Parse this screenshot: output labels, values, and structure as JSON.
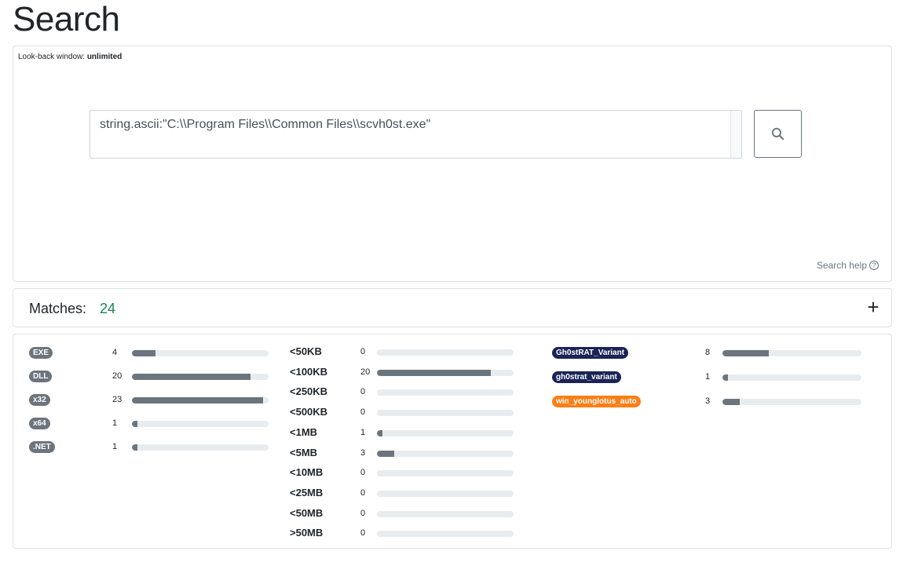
{
  "page_title": "Search",
  "search": {
    "lookback_label": "Look-back window:",
    "lookback_value": "unlimited",
    "query": "string.ascii:\"C:\\\\Program Files\\\\Common Files\\\\scvh0st.exe\"",
    "help_label": "Search help",
    "help_icon": "?"
  },
  "matches": {
    "label": "Matches:",
    "count": "24",
    "expand_icon": "+"
  },
  "facets": {
    "file_types": [
      {
        "label": "EXE",
        "count": "4",
        "fraction": 0.174
      },
      {
        "label": "DLL",
        "count": "20",
        "fraction": 0.87
      },
      {
        "label": "x32",
        "count": "23",
        "fraction": 0.96
      },
      {
        "label": "x64",
        "count": "1",
        "fraction": 0.043
      },
      {
        "label": ".NET",
        "count": "1",
        "fraction": 0.043
      }
    ],
    "sizes": [
      {
        "label": "<50KB",
        "count": "0",
        "fraction": 0
      },
      {
        "label": "<100KB",
        "count": "20",
        "fraction": 0.835
      },
      {
        "label": "<250KB",
        "count": "0",
        "fraction": 0
      },
      {
        "label": "<500KB",
        "count": "0",
        "fraction": 0
      },
      {
        "label": "<1MB",
        "count": "1",
        "fraction": 0.042
      },
      {
        "label": "<5MB",
        "count": "3",
        "fraction": 0.125
      },
      {
        "label": "<10MB",
        "count": "0",
        "fraction": 0
      },
      {
        "label": "<25MB",
        "count": "0",
        "fraction": 0
      },
      {
        "label": "<50MB",
        "count": "0",
        "fraction": 0
      },
      {
        "label": ">50MB",
        "count": "0",
        "fraction": 0
      }
    ],
    "families": [
      {
        "label": "Gh0stRAT_Variant",
        "count": "8",
        "fraction": 0.333,
        "color": "#1a2456"
      },
      {
        "label": "gh0strat_variant",
        "count": "1",
        "fraction": 0.042,
        "color": "#1a2456"
      },
      {
        "label": "win_younglotus_auto",
        "count": "3",
        "fraction": 0.125,
        "color": "#fd7e14"
      }
    ]
  },
  "colors": {
    "bar_fill": "#6c757d",
    "bar_track": "#e9ecef",
    "match_count": "#198754"
  }
}
